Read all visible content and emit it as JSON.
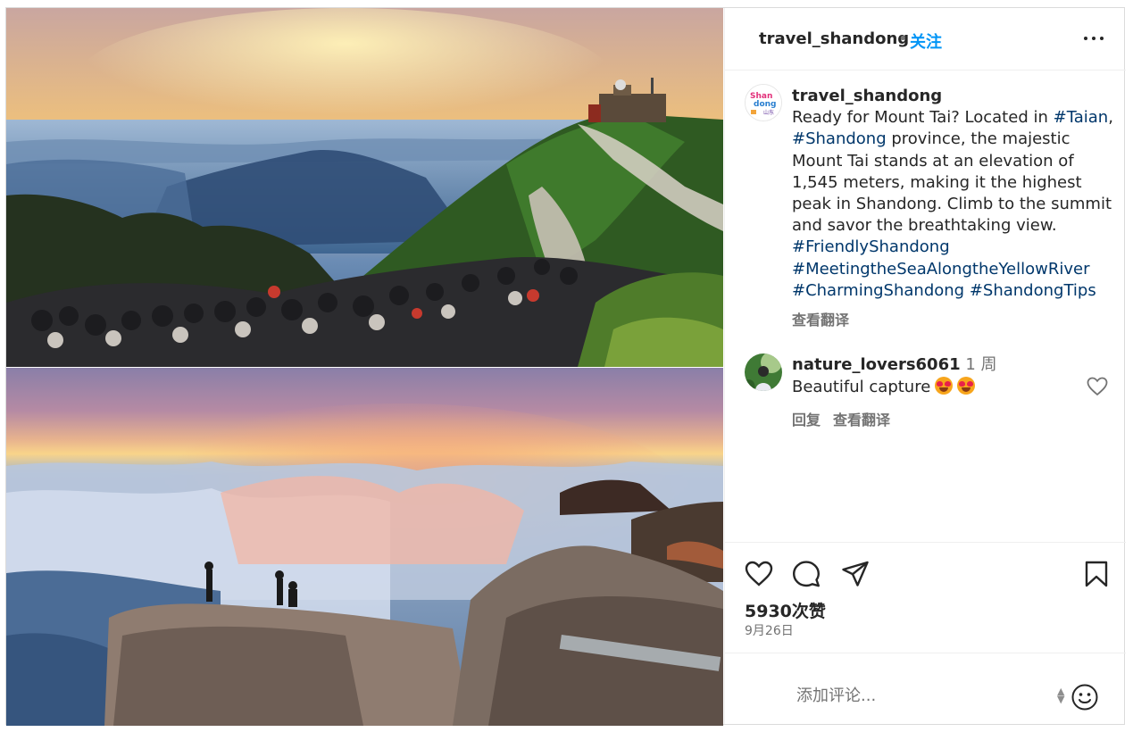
{
  "post": {
    "username": "travel_shandong",
    "separator": "•",
    "follow_label": "关注",
    "more_icon": "more-horizontal-icon"
  },
  "caption": {
    "username": "travel_shandong",
    "text_1": "Ready for Mount Tai? Located in ",
    "tag_taian": "#Taian",
    "text_2": ", ",
    "tag_shandong": "#Shandong",
    "text_3": " province, the majestic Mount Tai stands at an elevation of 1,545 meters, making it the highest peak in Shandong. Climb to the summit and savor the breathtaking view. ",
    "tag_friendly": "#FriendlyShandong",
    "tag_meeting": "#MeetingtheSeaAlongtheYellowRiver",
    "tag_charming": "#CharmingShandong",
    "tag_tips": "#ShandongTips",
    "see_translation": "查看翻译"
  },
  "avatar_logo": {
    "line1": "Shan",
    "line2": "dong",
    "line3": "山东"
  },
  "comment": {
    "username": "nature_lovers6061",
    "time": "1 周",
    "text": "Beautiful capture",
    "reply_label": "回复",
    "see_translation": "查看翻译"
  },
  "actions": {
    "likes": "5930次赞",
    "date": "9月26日"
  },
  "composer": {
    "placeholder": "添加评论..."
  },
  "colors": {
    "link": "#0095f6",
    "hashtag": "#00376b",
    "muted": "#737373"
  }
}
